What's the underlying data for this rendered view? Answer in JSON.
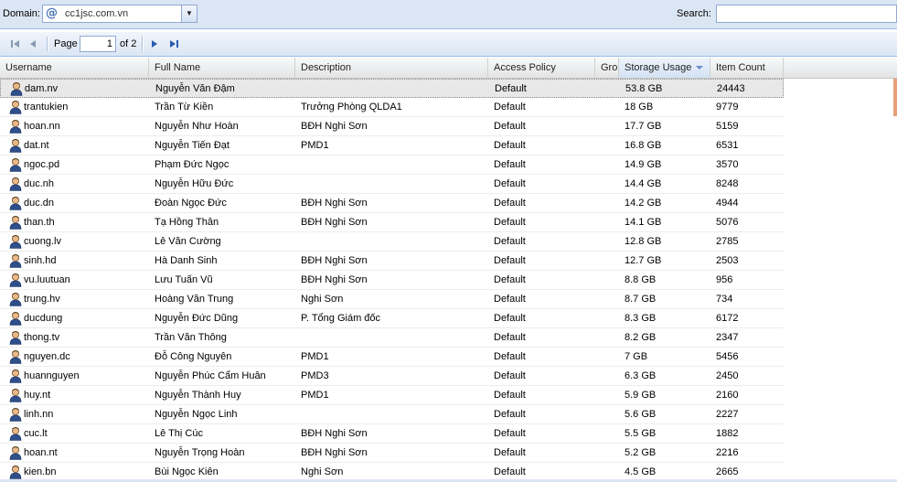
{
  "toolbar": {
    "domain_label": "Domain:",
    "domain_value": "cc1jsc.com.vn",
    "search_label": "Search:",
    "search_value": ""
  },
  "paging": {
    "page_label": "Page",
    "current_page": "1",
    "of_label": "of 2"
  },
  "grid": {
    "columns": [
      "Username",
      "Full Name",
      "Description",
      "Access Policy",
      "Gro",
      "Storage Usage",
      "Item Count"
    ],
    "rows": [
      {
        "username": "dam.nv",
        "fullname": "Nguyễn Văn Đậm",
        "description": "",
        "policy": "Default",
        "storage": "53.8 GB",
        "items": "24443"
      },
      {
        "username": "trantukien",
        "fullname": "Trần Từ Kiền",
        "description": "Trưởng Phòng QLDA1",
        "policy": "Default",
        "storage": "18 GB",
        "items": "9779"
      },
      {
        "username": "hoan.nn",
        "fullname": "Nguyễn Như Hoàn",
        "description": "BĐH Nghi Sơn",
        "policy": "Default",
        "storage": "17.7 GB",
        "items": "5159"
      },
      {
        "username": "dat.nt",
        "fullname": "Nguyễn Tiến Đạt",
        "description": "PMD1",
        "policy": "Default",
        "storage": "16.8 GB",
        "items": "6531"
      },
      {
        "username": "ngoc.pd",
        "fullname": "Phạm Đức Ngọc",
        "description": "",
        "policy": "Default",
        "storage": "14.9 GB",
        "items": "3570"
      },
      {
        "username": "duc.nh",
        "fullname": "Nguyễn Hữu Đức",
        "description": "",
        "policy": "Default",
        "storage": "14.4 GB",
        "items": "8248"
      },
      {
        "username": "duc.dn",
        "fullname": "Đoàn Ngọc Đức",
        "description": "BĐH Nghi Sơn",
        "policy": "Default",
        "storage": "14.2 GB",
        "items": "4944"
      },
      {
        "username": "than.th",
        "fullname": "Tạ Hồng Thân",
        "description": "BĐH Nghi Sơn",
        "policy": "Default",
        "storage": "14.1 GB",
        "items": "5076"
      },
      {
        "username": "cuong.lv",
        "fullname": "Lê Văn Cường",
        "description": "",
        "policy": "Default",
        "storage": "12.8 GB",
        "items": "2785"
      },
      {
        "username": "sinh.hd",
        "fullname": "Hà Danh Sinh",
        "description": " BĐH Nghi Sơn",
        "policy": "Default",
        "storage": "12.7 GB",
        "items": "2503"
      },
      {
        "username": "vu.luutuan",
        "fullname": "Lưu Tuấn Vũ",
        "description": "BĐH Nghi Sơn",
        "policy": "Default",
        "storage": "8.8 GB",
        "items": "956"
      },
      {
        "username": "trung.hv",
        "fullname": "Hoàng Văn Trung",
        "description": "Nghi Sơn",
        "policy": "Default",
        "storage": "8.7 GB",
        "items": "734"
      },
      {
        "username": "ducdung",
        "fullname": "Nguyễn Đức Dũng",
        "description": "P. Tổng Giám đốc",
        "policy": "Default",
        "storage": "8.3 GB",
        "items": "6172"
      },
      {
        "username": "thong.tv",
        "fullname": "Trần Văn Thông",
        "description": "",
        "policy": "Default",
        "storage": "8.2 GB",
        "items": "2347"
      },
      {
        "username": "nguyen.dc",
        "fullname": "Đỗ Công Nguyên",
        "description": "PMD1",
        "policy": "Default",
        "storage": "7 GB",
        "items": "5456"
      },
      {
        "username": "huannguyen",
        "fullname": "Nguyễn Phúc Cẩm Huân",
        "description": "PMD3",
        "policy": "Default",
        "storage": "6.3 GB",
        "items": "2450"
      },
      {
        "username": "huy.nt",
        "fullname": "Nguyễn Thành Huy",
        "description": "PMD1",
        "policy": "Default",
        "storage": "5.9 GB",
        "items": "2160"
      },
      {
        "username": "linh.nn",
        "fullname": "Nguyễn Ngọc Linh",
        "description": "",
        "policy": "Default",
        "storage": "5.6 GB",
        "items": "2227"
      },
      {
        "username": "cuc.lt",
        "fullname": "Lê Thị Cúc",
        "description": "BĐH Nghi Sơn",
        "policy": "Default",
        "storage": "5.5 GB",
        "items": "1882"
      },
      {
        "username": "hoan.nt",
        "fullname": "Nguyễn Trọng Hoàn",
        "description": "BĐH Nghi Sơn",
        "policy": "Default",
        "storage": "5.2 GB",
        "items": "2216"
      },
      {
        "username": "kien.bn",
        "fullname": "Bùi Ngọc Kiên",
        "description": "Nghi Sơn",
        "policy": "Default",
        "storage": "4.5 GB",
        "items": "2665"
      }
    ]
  },
  "icons": {
    "domain": "at-sign-icon",
    "row": "user-icon",
    "paging": [
      "first-page-icon",
      "prev-page-icon",
      "next-page-icon",
      "last-page-icon"
    ]
  },
  "colors": {
    "toolbar_bg": "#dbe6f4",
    "border": "#99bbe8",
    "selected_row": "#e8e8e8",
    "sort_arrow": "#6b8cc7",
    "nav_blue": "#2a5db0"
  }
}
